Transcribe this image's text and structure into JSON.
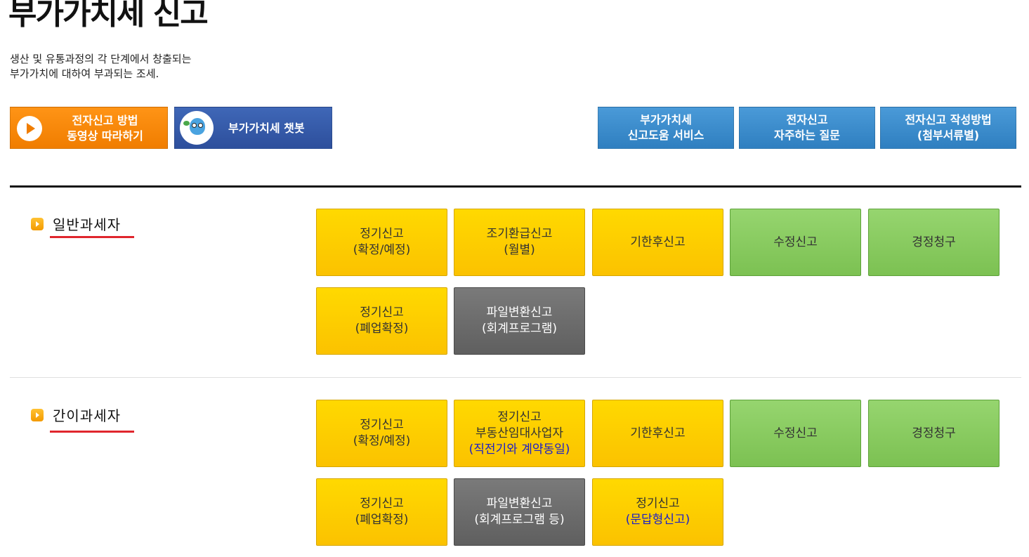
{
  "page": {
    "title": "부가가치세 신고",
    "description": [
      "생산 및 유통과정의 각 단계에서 창출되는",
      "부가가치에 대하여 부과되는 조세."
    ]
  },
  "top_buttons": {
    "video": [
      "전자신고 방법",
      "동영상 따라하기"
    ],
    "chatbot": "부가가치세 챗봇",
    "help_service": [
      "부가가치세",
      "신고도움 서비스"
    ],
    "faq": [
      "전자신고",
      "자주하는 질문"
    ],
    "guide": [
      "전자신고 작성방법",
      "(첨부서류별)"
    ]
  },
  "colors": {
    "orange": "#f07d00",
    "navy": "#2d4f9c",
    "blue": "#2f7fc0",
    "yellow": "#ffd900",
    "green": "#7cc152",
    "gray": "#6a6a6a",
    "red_underline": "#e0262d",
    "highlight_text": "#1c20c8"
  },
  "icons": {
    "video": "play-icon",
    "chatbot": "chatbot-mascot-icon",
    "section": "orange-arrow-bullet-icon"
  },
  "sections": [
    {
      "label": "일반과세자",
      "tiles": [
        {
          "lines": [
            "정기신고",
            "(확정/예정)"
          ],
          "color": "yellow"
        },
        {
          "lines": [
            "조기환급신고",
            "(월별)"
          ],
          "color": "yellow"
        },
        {
          "lines": [
            "기한후신고"
          ],
          "color": "yellow"
        },
        {
          "lines": [
            "수정신고"
          ],
          "color": "green"
        },
        {
          "lines": [
            "경정청구"
          ],
          "color": "green"
        },
        {
          "lines": [
            "정기신고",
            "(폐업확정)"
          ],
          "color": "yellow"
        },
        {
          "lines": [
            "파일변환신고",
            "(회계프로그램)"
          ],
          "color": "gray"
        }
      ]
    },
    {
      "label": "간이과세자",
      "tiles": [
        {
          "lines": [
            "정기신고",
            "(확정/예정)"
          ],
          "color": "yellow"
        },
        {
          "lines": [
            "정기신고",
            "부동산임대사업자",
            "(직전기와 계약동일)"
          ],
          "color": "yellow"
        },
        {
          "lines": [
            "기한후신고"
          ],
          "color": "yellow"
        },
        {
          "lines": [
            "수정신고"
          ],
          "color": "green"
        },
        {
          "lines": [
            "경정청구"
          ],
          "color": "green"
        },
        {
          "lines": [
            "정기신고",
            "(폐업확정)"
          ],
          "color": "yellow"
        },
        {
          "lines": [
            "파일변환신고",
            "(회계프로그램 등)"
          ],
          "color": "gray"
        },
        {
          "lines": [
            "정기신고",
            "(문답형신고)"
          ],
          "color": "yellow"
        }
      ]
    }
  ]
}
